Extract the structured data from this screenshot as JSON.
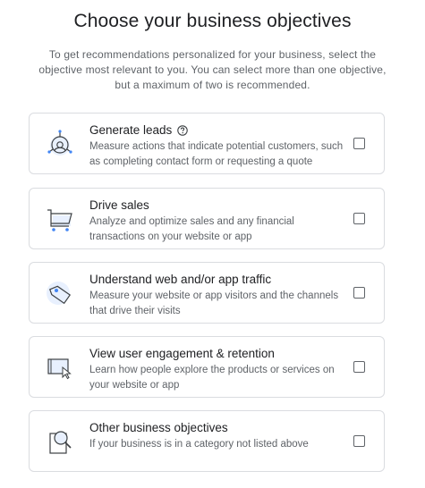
{
  "header": {
    "title": "Choose your business objectives",
    "subtitle": "To get recommendations personalized for your business, select the objective most relevant to you. You can select more than one objective, but a maximum of two is recommended."
  },
  "objectives": [
    {
      "title": "Generate leads",
      "description": "Measure actions that indicate potential customers, such as completing contact form or requesting a quote",
      "icon": "target-person-icon",
      "has_help": true,
      "checked": false
    },
    {
      "title": "Drive sales",
      "description": "Analyze and optimize sales and any financial transactions on your website or app",
      "icon": "shopping-cart-icon",
      "has_help": false,
      "checked": false
    },
    {
      "title": "Understand web and/or app traffic",
      "description": "Measure your website or app visitors and the channels that drive their visits",
      "icon": "tag-icon",
      "has_help": false,
      "checked": false
    },
    {
      "title": "View user engagement & retention",
      "description": "Learn how people explore the products or services on your website or app",
      "icon": "screen-cursor-icon",
      "has_help": false,
      "checked": false
    },
    {
      "title": "Other business objectives",
      "description": "If your business is in a category not listed above",
      "icon": "magnifier-document-icon",
      "has_help": false,
      "checked": false
    }
  ],
  "colors": {
    "accent_light": "#e8f0fe",
    "accent": "#4285f4",
    "border": "#dadce0",
    "text_primary": "#202124",
    "text_secondary": "#5f6368"
  }
}
